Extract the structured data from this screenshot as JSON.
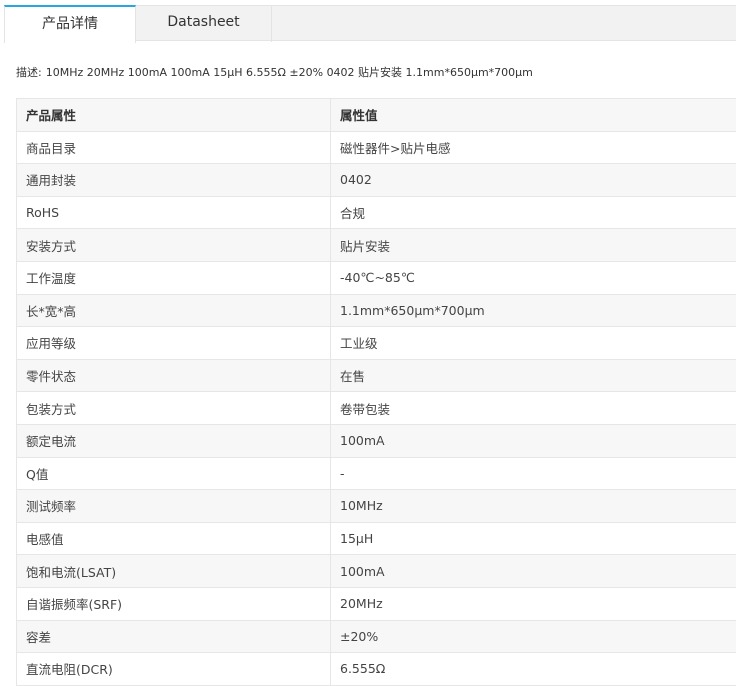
{
  "tabs": [
    {
      "label": "产品详情",
      "active": true
    },
    {
      "label": "Datasheet",
      "active": false
    }
  ],
  "description": {
    "label": "描述:",
    "text": "10MHz 20MHz 100mA 100mA 15μH 6.555Ω ±20% 0402 贴片安装 1.1mm*650μm*700μm"
  },
  "table": {
    "headers": [
      "产品属性",
      "属性值"
    ],
    "rows": [
      {
        "attr": "商品目录",
        "value": "磁性器件>贴片电感"
      },
      {
        "attr": "通用封装",
        "value": "0402"
      },
      {
        "attr": "RoHS",
        "value": "合规"
      },
      {
        "attr": "安装方式",
        "value": "贴片安装"
      },
      {
        "attr": "工作温度",
        "value": "-40℃~85℃"
      },
      {
        "attr": "长*宽*高",
        "value": "1.1mm*650μm*700μm"
      },
      {
        "attr": "应用等级",
        "value": "工业级"
      },
      {
        "attr": "零件状态",
        "value": "在售"
      },
      {
        "attr": "包装方式",
        "value": "卷带包装"
      },
      {
        "attr": "额定电流",
        "value": "100mA"
      },
      {
        "attr": "Q值",
        "value": "-"
      },
      {
        "attr": "测试频率",
        "value": "10MHz"
      },
      {
        "attr": "电感值",
        "value": "15μH"
      },
      {
        "attr": "饱和电流(LSAT)",
        "value": "100mA"
      },
      {
        "attr": "自谐振频率(SRF)",
        "value": "20MHz"
      },
      {
        "attr": "容差",
        "value": "±20%"
      },
      {
        "attr": "直流电阻(DCR)",
        "value": "6.555Ω"
      }
    ]
  },
  "colors": {
    "active_tab_border": "#27a7e0",
    "tabbar_bg": "#f2f2f2",
    "header_bg": "#f7f7f7",
    "stripe_bg": "#f7f7f7",
    "border": "#e6e6e6"
  }
}
